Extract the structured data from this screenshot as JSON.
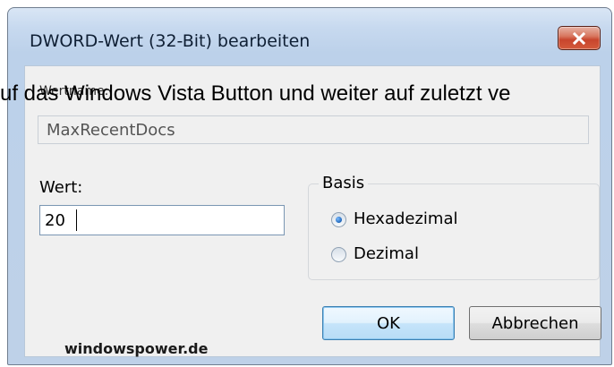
{
  "dialog": {
    "title": "DWORD-Wert (32-Bit) bearbeiten",
    "close_icon": "close-icon"
  },
  "overlay": {
    "text": "uf das Windows Vista Button und weiter auf zuletzt ve"
  },
  "value_name": {
    "label": "Wertname:",
    "value": "MaxRecentDocs"
  },
  "value_data": {
    "label": "Wert:",
    "value": "20"
  },
  "base": {
    "label": "Basis",
    "options": [
      {
        "label": "Hexadezimal",
        "selected": true
      },
      {
        "label": "Dezimal",
        "selected": false
      }
    ]
  },
  "buttons": {
    "ok_label": "OK",
    "cancel_label": "Abbrechen"
  },
  "watermark": {
    "text": "windowspower.de"
  },
  "colors": {
    "title_text": "#0f1f34",
    "close_button": "#c8452d",
    "accent_blue": "#1f66ba"
  }
}
